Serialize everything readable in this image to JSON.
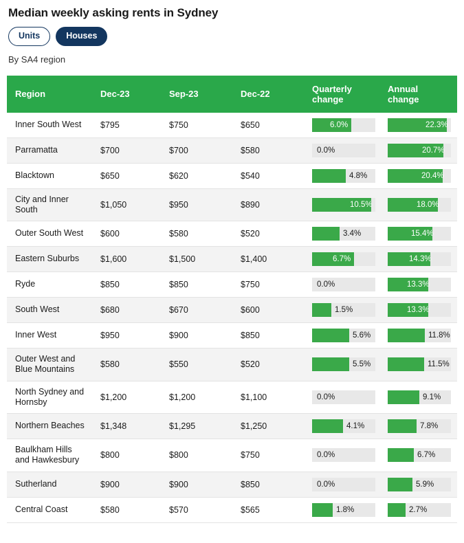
{
  "header": {
    "title": "Median weekly asking rents in Sydney",
    "subtitle": "By SA4 region"
  },
  "toggles": [
    {
      "label": "Units",
      "active": false
    },
    {
      "label": "Houses",
      "active": true
    }
  ],
  "colors": {
    "header_green": "#2aa84a",
    "bar_green": "#3aa949",
    "bar_track": "#e8e8e8",
    "pill_navy": "#13365f",
    "alt_row": "#f3f3f3"
  },
  "chart_data": {
    "type": "table",
    "title": "Median weekly asking rents in Sydney",
    "subtitle": "By SA4 region",
    "columns": [
      "Region",
      "Dec-23",
      "Sep-23",
      "Dec-22",
      "Quarterly change",
      "Annual change"
    ],
    "quarterly_max": 10.5,
    "annual_max": 22.3,
    "rows": [
      {
        "region": "Inner South West",
        "dec23": "$795",
        "sep23": "$750",
        "dec22": "$650",
        "quarterly": "6.0%",
        "quarterly_value": 6.0,
        "annual": "22.3%",
        "annual_value": 22.3
      },
      {
        "region": "Parramatta",
        "dec23": "$700",
        "sep23": "$700",
        "dec22": "$580",
        "quarterly": "0.0%",
        "quarterly_value": 0.0,
        "annual": "20.7%",
        "annual_value": 20.7
      },
      {
        "region": "Blacktown",
        "dec23": "$650",
        "sep23": "$620",
        "dec22": "$540",
        "quarterly": "4.8%",
        "quarterly_value": 4.8,
        "annual": "20.4%",
        "annual_value": 20.4
      },
      {
        "region": "City and Inner South",
        "dec23": "$1,050",
        "sep23": "$950",
        "dec22": "$890",
        "quarterly": "10.5%",
        "quarterly_value": 10.5,
        "annual": "18.0%",
        "annual_value": 18.0
      },
      {
        "region": "Outer South West",
        "dec23": "$600",
        "sep23": "$580",
        "dec22": "$520",
        "quarterly": "3.4%",
        "quarterly_value": 3.4,
        "annual": "15.4%",
        "annual_value": 15.4
      },
      {
        "region": "Eastern Suburbs",
        "dec23": "$1,600",
        "sep23": "$1,500",
        "dec22": "$1,400",
        "quarterly": "6.7%",
        "quarterly_value": 6.7,
        "annual": "14.3%",
        "annual_value": 14.3
      },
      {
        "region": "Ryde",
        "dec23": "$850",
        "sep23": "$850",
        "dec22": "$750",
        "quarterly": "0.0%",
        "quarterly_value": 0.0,
        "annual": "13.3%",
        "annual_value": 13.3
      },
      {
        "region": "South West",
        "dec23": "$680",
        "sep23": "$670",
        "dec22": "$600",
        "quarterly": "1.5%",
        "quarterly_value": 1.5,
        "annual": "13.3%",
        "annual_value": 13.3
      },
      {
        "region": "Inner West",
        "dec23": "$950",
        "sep23": "$900",
        "dec22": "$850",
        "quarterly": "5.6%",
        "quarterly_value": 5.6,
        "annual": "11.8%",
        "annual_value": 11.8
      },
      {
        "region": "Outer West and Blue Mountains",
        "dec23": "$580",
        "sep23": "$550",
        "dec22": "$520",
        "quarterly": "5.5%",
        "quarterly_value": 5.5,
        "annual": "11.5%",
        "annual_value": 11.5
      },
      {
        "region": "North Sydney and Hornsby",
        "dec23": "$1,200",
        "sep23": "$1,200",
        "dec22": "$1,100",
        "quarterly": "0.0%",
        "quarterly_value": 0.0,
        "annual": "9.1%",
        "annual_value": 9.1
      },
      {
        "region": "Northern Beaches",
        "dec23": "$1,348",
        "sep23": "$1,295",
        "dec22": "$1,250",
        "quarterly": "4.1%",
        "quarterly_value": 4.1,
        "annual": "7.8%",
        "annual_value": 7.8
      },
      {
        "region": "Baulkham Hills and Hawkesbury",
        "dec23": "$800",
        "sep23": "$800",
        "dec22": "$750",
        "quarterly": "0.0%",
        "quarterly_value": 0.0,
        "annual": "6.7%",
        "annual_value": 6.7
      },
      {
        "region": "Sutherland",
        "dec23": "$900",
        "sep23": "$900",
        "dec22": "$850",
        "quarterly": "0.0%",
        "quarterly_value": 0.0,
        "annual": "5.9%",
        "annual_value": 5.9
      },
      {
        "region": "Central Coast",
        "dec23": "$580",
        "sep23": "$570",
        "dec22": "$565",
        "quarterly": "1.8%",
        "quarterly_value": 1.8,
        "annual": "2.7%",
        "annual_value": 2.7
      }
    ]
  }
}
